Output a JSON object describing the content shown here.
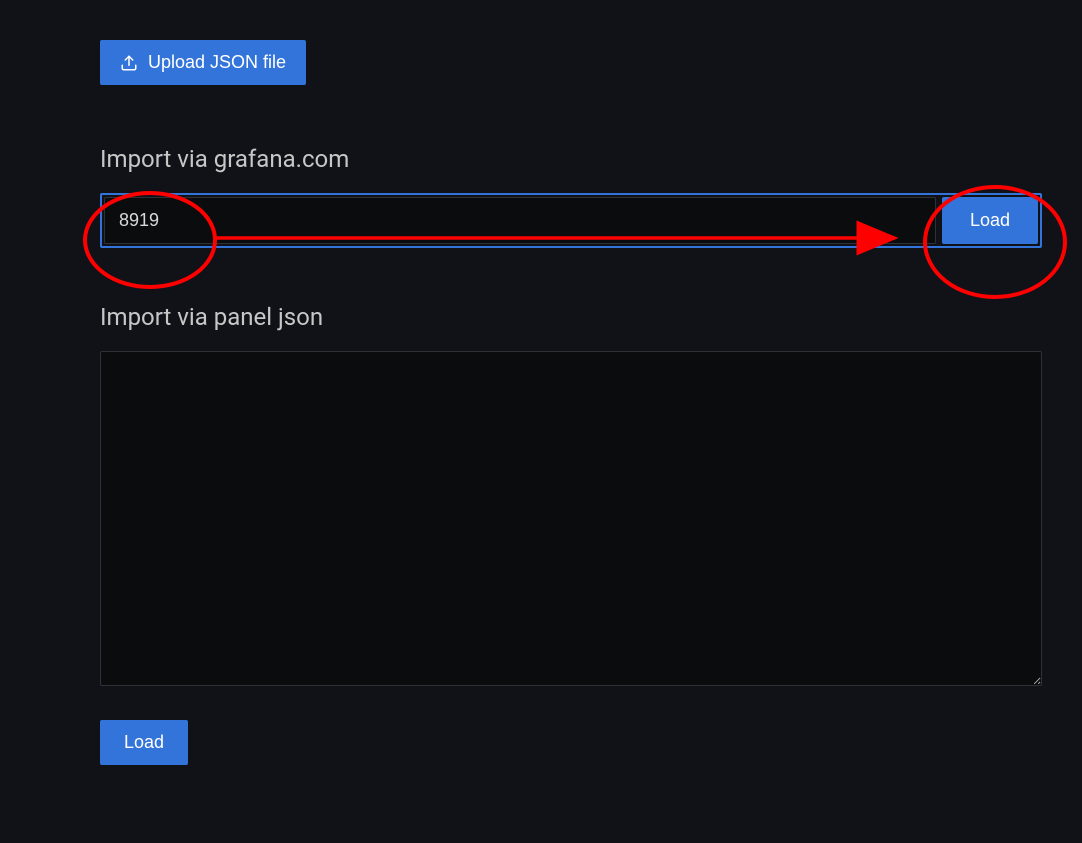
{
  "upload": {
    "label": "Upload JSON file"
  },
  "importGrafana": {
    "heading": "Import via grafana.com",
    "value": "8919",
    "loadLabel": "Load"
  },
  "importPanelJson": {
    "heading": "Import via panel json",
    "value": "",
    "loadLabel": "Load"
  },
  "colors": {
    "accent": "#3274d9",
    "background": "#111217",
    "inputBg": "#0b0c0e",
    "annotation": "#ff0000"
  }
}
